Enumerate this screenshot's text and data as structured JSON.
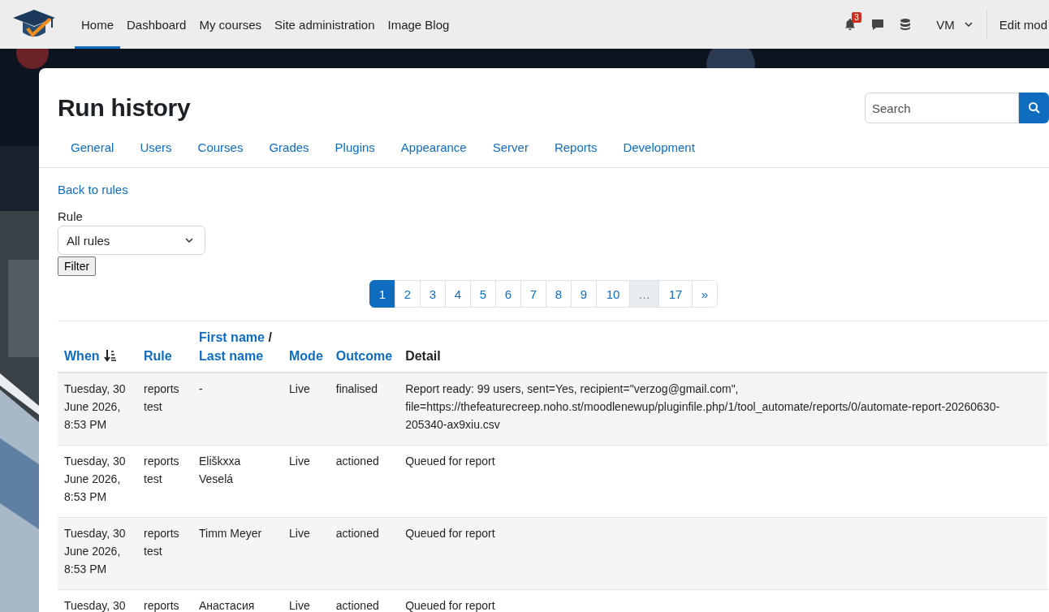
{
  "navbar": {
    "items": [
      {
        "label": "Home",
        "selected": true
      },
      {
        "label": "Dashboard",
        "selected": false
      },
      {
        "label": "My courses",
        "selected": false
      },
      {
        "label": "Site administration",
        "selected": false
      },
      {
        "label": "Image Blog",
        "selected": false
      }
    ],
    "notification_count": "3",
    "user_initials": "VM",
    "edit_mode_label": "Edit mod"
  },
  "page": {
    "title": "Run history",
    "search": {
      "placeholder": "Search"
    },
    "tabs": [
      {
        "label": "General"
      },
      {
        "label": "Users"
      },
      {
        "label": "Courses"
      },
      {
        "label": "Grades"
      },
      {
        "label": "Plugins"
      },
      {
        "label": "Appearance"
      },
      {
        "label": "Server"
      },
      {
        "label": "Reports"
      },
      {
        "label": "Development"
      }
    ],
    "back_link": "Back to rules",
    "rule_filter": {
      "label": "Rule",
      "value": "All rules",
      "button": "Filter"
    },
    "pagination": [
      {
        "label": "1",
        "selected": true,
        "kind": "page"
      },
      {
        "label": "2",
        "selected": false,
        "kind": "page"
      },
      {
        "label": "3",
        "selected": false,
        "kind": "page"
      },
      {
        "label": "4",
        "selected": false,
        "kind": "page"
      },
      {
        "label": "5",
        "selected": false,
        "kind": "page"
      },
      {
        "label": "6",
        "selected": false,
        "kind": "page"
      },
      {
        "label": "7",
        "selected": false,
        "kind": "page"
      },
      {
        "label": "8",
        "selected": false,
        "kind": "page"
      },
      {
        "label": "9",
        "selected": false,
        "kind": "page"
      },
      {
        "label": "10",
        "selected": false,
        "kind": "page"
      },
      {
        "label": "…",
        "selected": false,
        "kind": "gap"
      },
      {
        "label": "17",
        "selected": false,
        "kind": "page"
      },
      {
        "label": "»",
        "selected": false,
        "kind": "page"
      }
    ]
  },
  "table": {
    "columns": [
      {
        "parts": [
          {
            "text": "When",
            "link": true
          }
        ],
        "sorted": true
      },
      {
        "parts": [
          {
            "text": "Rule",
            "link": true
          }
        ],
        "sorted": false
      },
      {
        "parts": [
          {
            "text": "First name",
            "link": true
          },
          {
            "text": "/",
            "link": false
          },
          {
            "text": "Last name",
            "link": true
          }
        ],
        "sorted": false
      },
      {
        "parts": [
          {
            "text": "Mode",
            "link": true
          }
        ],
        "sorted": false
      },
      {
        "parts": [
          {
            "text": "Outcome",
            "link": true
          }
        ],
        "sorted": false
      },
      {
        "parts": [
          {
            "text": "Detail",
            "link": false
          }
        ],
        "sorted": false
      }
    ],
    "rows": [
      [
        "Tuesday, 30 June 2026, 8:53 PM",
        "reports test",
        "-",
        "Live",
        "finalised",
        "Report ready: 99 users, sent=Yes, recipient=\"verzog@gmail.com\", file=https://thefeaturecreep.noho.st/moodlenewup/pluginfile.php/1/tool_automate/reports/0/automate-report-20260630-205340-ax9xiu.csv"
      ],
      [
        "Tuesday, 30 June 2026, 8:53 PM",
        "reports test",
        "Eliškxxa Veselá",
        "Live",
        "actioned",
        "Queued for report"
      ],
      [
        "Tuesday, 30 June 2026, 8:53 PM",
        "reports test",
        "Timm Meyer",
        "Live",
        "actioned",
        "Queued for report"
      ],
      [
        "Tuesday, 30",
        "reports",
        "Анастасия",
        "Live",
        "actioned",
        "Queued for report"
      ]
    ]
  }
}
